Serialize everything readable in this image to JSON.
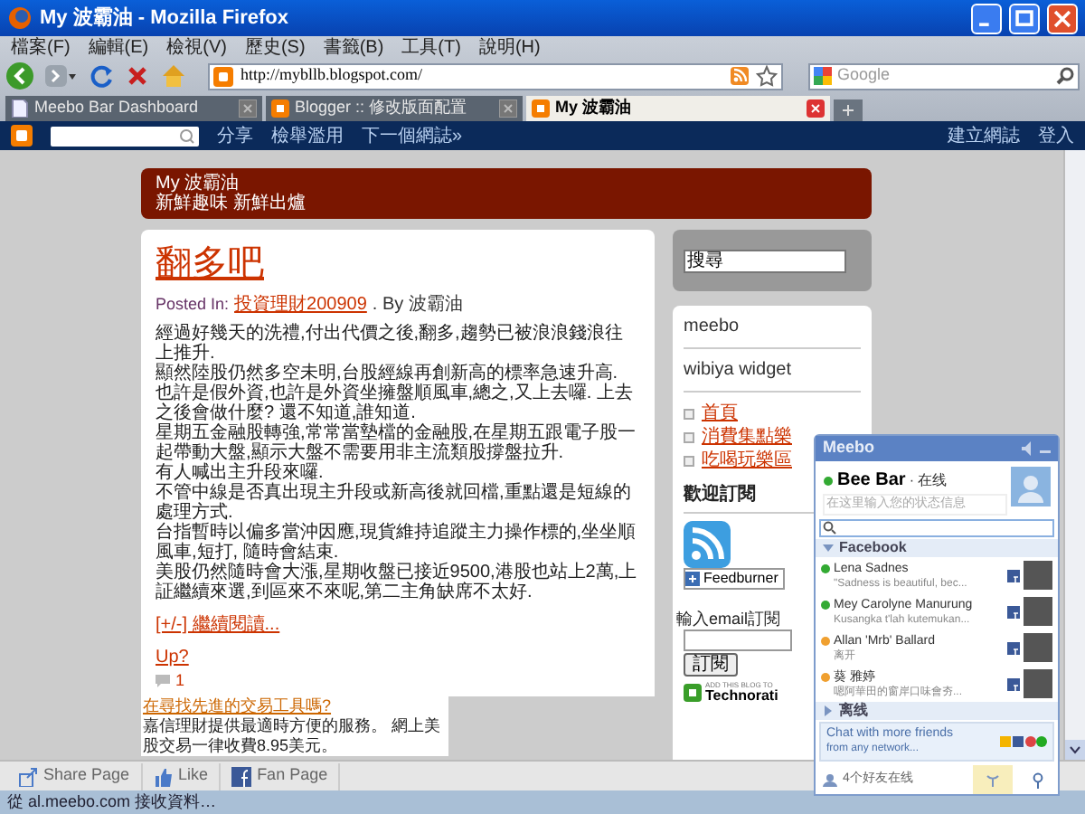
{
  "window": {
    "title": "My 波霸油 - Mozilla Firefox"
  },
  "menu": [
    "檔案(F)",
    "編輯(E)",
    "檢視(V)",
    "歷史(S)",
    "書籤(B)",
    "工具(T)",
    "說明(H)"
  ],
  "toolbar": {
    "url": "http://mybllb.blogspot.com/",
    "search_placeholder": "Google"
  },
  "tabs": [
    {
      "label": "Meebo Bar Dashboard",
      "selected": false,
      "kind": "page"
    },
    {
      "label": "Blogger :: 修改版面配置",
      "selected": false,
      "kind": "blogger"
    },
    {
      "label": "My 波霸油",
      "selected": true,
      "kind": "blogger"
    }
  ],
  "navbar": {
    "links": [
      "分享",
      "檢舉濫用",
      "下一個網誌»"
    ],
    "right_links": [
      "建立網誌",
      "登入"
    ]
  },
  "header": {
    "title": "My 波霸油",
    "description": "新鮮趣味 新鮮出爐"
  },
  "post": {
    "title": "翻多吧",
    "posted_in_label": "Posted In:",
    "category": "投資理財200909",
    "author": ". By 波霸油",
    "paragraphs": [
      "經過好幾天的洗禮,付出代價之後,翻多,趨勢已被浪浪錢浪往上推升.",
      "顯然陸股仍然多空未明,台股經線再創新高的標率急速升高.",
      "也許是假外資,也許是外資坐擁盤順風車,總之,又上去囉. 上去之後會做什麼? 還不知道,誰知道.",
      "星期五金融股轉強,常常當墊檔的金融股,在星期五跟電子股一起帶動大盤,顯示大盤不需要用非主流類股撐盤拉升.",
      "有人喊出主升段來囉.",
      "不管中線是否真出現主升段或新高後就回檔,重點還是短線的處理方式.",
      "台指暫時以偏多當沖因應,現貨維持追蹤主力操作標的,坐坐順風車,短打, 隨時會結束.",
      "美股仍然隨時會大漲,星期收盤已接近9500,港股也站上2萬,上証繼續來選,到區來不來呢,第二主角缺席不太好."
    ],
    "read_more": "[+/-] 繼續閱讀...",
    "up": "Up?",
    "comments": "1"
  },
  "ad": {
    "title": "在尋找先進的交易工具嗎?",
    "text": "嘉信理財提供最適時方便的服務。 網上美股交易一律收費8.95美元。"
  },
  "sidebar": {
    "search_value": "搜尋",
    "widgets": [
      "meebo",
      "wibiya widget"
    ],
    "links": [
      "首頁",
      "消費集點樂",
      "吃喝玩樂區"
    ],
    "subscribe_heading": "歡迎訂閱",
    "feedburner": "Feedburner",
    "email_label": "輸入email訂閱",
    "subscribe_button": "訂閱",
    "technorati_top": "ADD THIS BLOG TO",
    "technorati": "Technorati"
  },
  "meebo_bar": {
    "buttons": [
      {
        "label": "Share Page",
        "kind": "share"
      },
      {
        "label": "Like",
        "kind": "like"
      },
      {
        "label": "Fan Page",
        "kind": "facebook"
      }
    ]
  },
  "status_bar": "從 al.meebo.com 接收資料…",
  "meebo": {
    "title": "Meebo",
    "name": "Bee Bar",
    "presence": "· 在线",
    "status_placeholder": "在这里输入您的状态信息",
    "groups": [
      {
        "name": "Facebook",
        "expanded": true,
        "contacts": [
          {
            "name": "Lena Sadnes",
            "message": "\"Sadness is beautiful, bec...",
            "color": "#33aa33"
          },
          {
            "name": "Mey Carolyne Manurung",
            "message": "Kusangka t'lah kutemukan...",
            "color": "#33aa33"
          },
          {
            "name": "Allan 'Mrb' Ballard",
            "message": "离开",
            "color": "#f0a030"
          },
          {
            "name": "葵 雅婷",
            "message": "嗯阿華田的窗岸口味會夯...",
            "color": "#f0a030"
          }
        ]
      },
      {
        "name": "离线",
        "expanded": false
      }
    ],
    "promo": "Chat with more friends",
    "promo_link": "from any network...",
    "online_count": "4个好友在线"
  }
}
